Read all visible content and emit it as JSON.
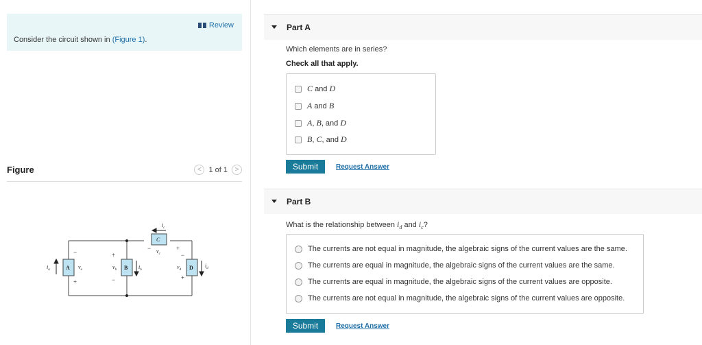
{
  "left": {
    "review_label": "Review",
    "intro_prefix": "Consider the circuit shown in ",
    "intro_link": "(Figure 1)",
    "intro_suffix": ".",
    "figure_title": "Figure",
    "pager_text": "1 of 1",
    "prev_glyph": "<",
    "next_glyph": ">"
  },
  "circuit": {
    "labels": {
      "ia": "i",
      "ia_sub": "a",
      "A": "A",
      "va": "v",
      "va_sub": "a",
      "vb": "v",
      "vb_sub": "b",
      "B": "B",
      "ib": "i",
      "ib_sub": "b",
      "C": "C",
      "ic": "i",
      "ic_sub": "c",
      "vc": "v",
      "vc_sub": "c",
      "vd": "v",
      "vd_sub": "d",
      "D": "D",
      "id": "i",
      "id_sub": "d",
      "plus": "+",
      "minus": "−"
    },
    "box_fill": "#bde3f3"
  },
  "partA": {
    "title": "Part A",
    "question": "Which elements are in series?",
    "instruction": "Check all that apply.",
    "options": [
      {
        "a": "C",
        "j1": " and ",
        "b": "D",
        "j2": "",
        "c": "",
        "j3": "",
        "d": ""
      },
      {
        "a": "A",
        "j1": " and ",
        "b": "B",
        "j2": "",
        "c": "",
        "j3": "",
        "d": ""
      },
      {
        "a": "A",
        "j1": ", ",
        "b": "B",
        "j2": ", and ",
        "c": "D",
        "j3": "",
        "d": ""
      },
      {
        "a": "B",
        "j1": ", ",
        "b": "C",
        "j2": ", and ",
        "c": "D",
        "j3": "",
        "d": ""
      }
    ],
    "submit_label": "Submit",
    "request_label": "Request Answer"
  },
  "partB": {
    "title": "Part B",
    "question_prefix": "What is the relationship between ",
    "var1": "i",
    "var1_sub": "d",
    "question_mid": " and ",
    "var2": "i",
    "var2_sub": "c",
    "question_suffix": "?",
    "options": [
      "The currents are not equal in magnitude, the algebraic signs of the current values are the same.",
      "The currents are equal in magnitude, the algebraic signs of the current values are the same.",
      "The currents are equal in magnitude, the algebraic signs of the current values are opposite.",
      "The currents are not equal in magnitude, the algebraic signs of the current values are opposite."
    ],
    "submit_label": "Submit",
    "request_label": "Request Answer"
  },
  "colors": {
    "accent": "#1a7a9a",
    "link": "#1f6fa8",
    "intro_bg": "#e8f6f8"
  }
}
